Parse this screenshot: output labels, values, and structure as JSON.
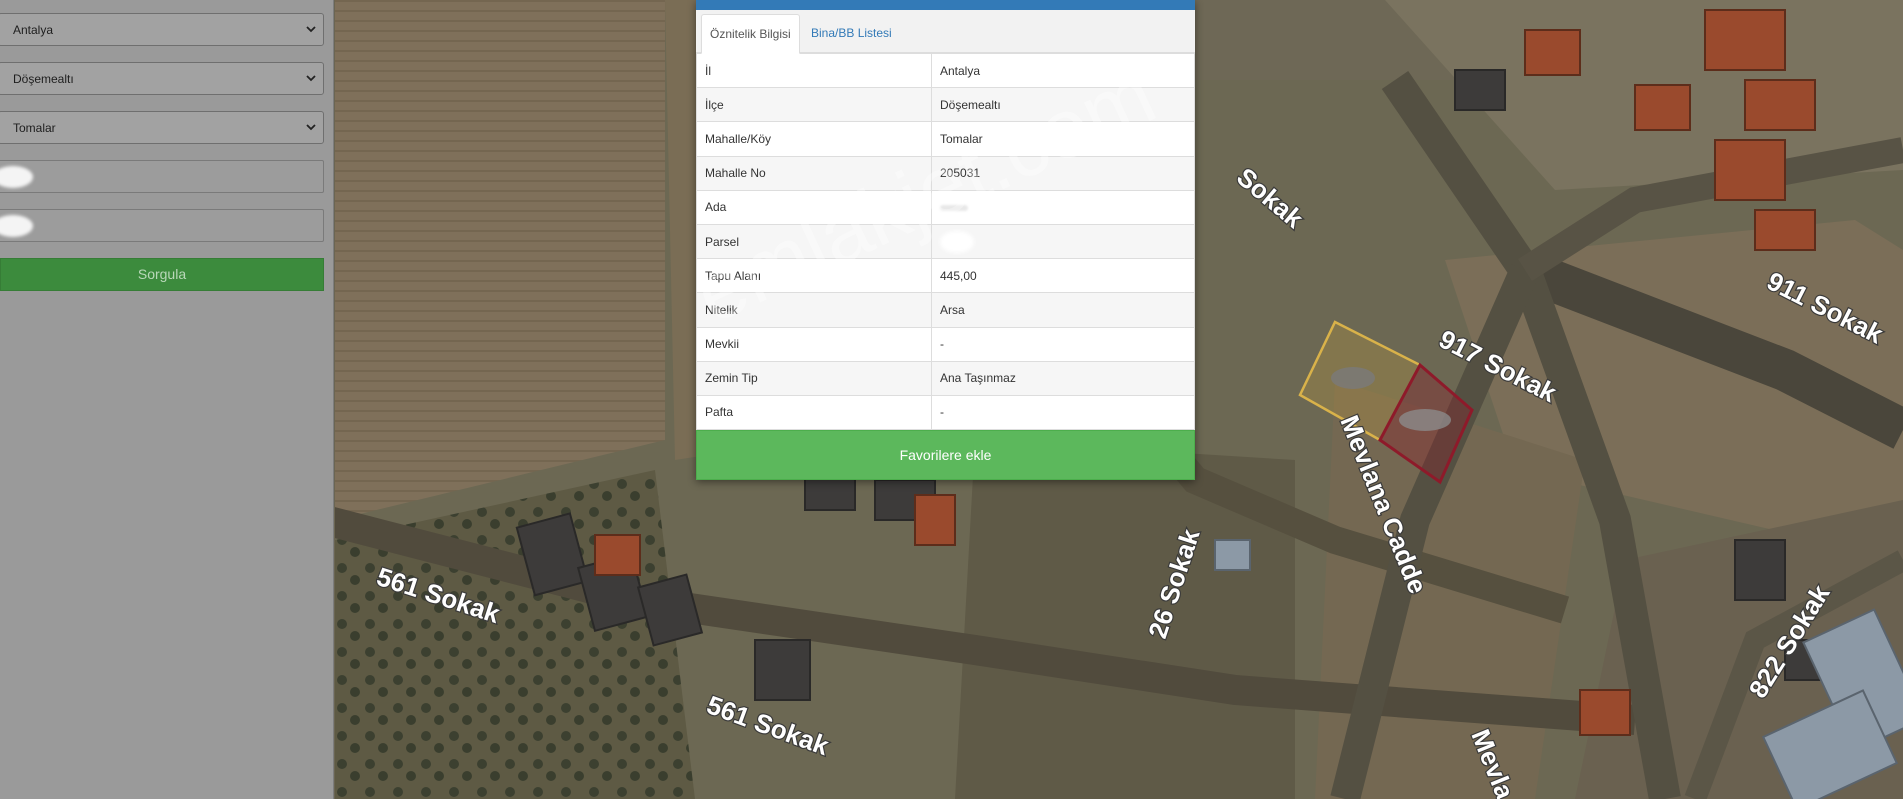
{
  "left_panel": {
    "selects": [
      {
        "value": "Antalya"
      },
      {
        "value": "Döşemealtı"
      },
      {
        "value": "Tomalar"
      }
    ],
    "query_button": "Sorgula"
  },
  "popup": {
    "tabs": [
      {
        "label": "Öznitelik Bilgisi",
        "active": true
      },
      {
        "label": "Bina/BB Listesi",
        "active": false
      }
    ],
    "rows": [
      {
        "key": "İl",
        "value": "Antalya"
      },
      {
        "key": "İlçe",
        "value": "Döşemealtı"
      },
      {
        "key": "Mahalle/Köy",
        "value": "Tomalar"
      },
      {
        "key": "Mahalle No",
        "value": "205031"
      },
      {
        "key": "Ada",
        "value": ""
      },
      {
        "key": "Parsel",
        "value": ""
      },
      {
        "key": "Tapu Alanı",
        "value": "445,00"
      },
      {
        "key": "Nitelik",
        "value": "Arsa"
      },
      {
        "key": "Mevkii",
        "value": "-"
      },
      {
        "key": "Zemin Tip",
        "value": "Ana Taşınmaz"
      },
      {
        "key": "Pafta",
        "value": "-"
      }
    ],
    "favorite_button": "Favorilere ekle"
  },
  "map": {
    "road_labels": [
      "561 Sokak",
      "561 Sokak",
      "26 Sokak",
      "Mevlana Cadde",
      "Mevla",
      "917 Sokak",
      "911 Sokak",
      "822 Sokak",
      "Sokak"
    ]
  },
  "watermark": "emlakjet.com",
  "colors": {
    "header_blue": "#337ab7",
    "favorite_green": "#5cb85c",
    "query_green": "#3c8b3d",
    "parcel_yellow": "#d9b24a",
    "parcel_red": "#8e1a2a"
  }
}
